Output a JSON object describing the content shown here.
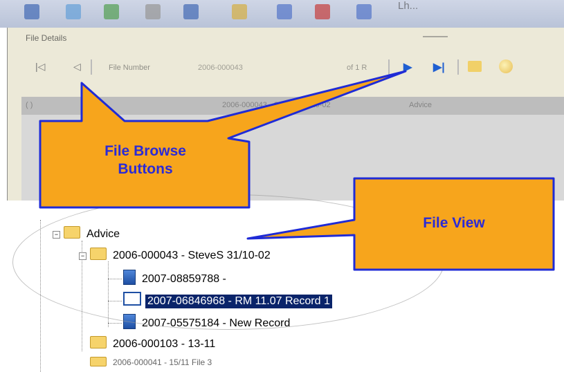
{
  "toolbar_strip": {
    "partial_text": "Lh..."
  },
  "file_details": {
    "title": "File Details",
    "field_label": "File Number",
    "field_value": "2006-000043",
    "record_count": "of 1 R",
    "grid_headers": [
      "( )",
      "2006-000043 - SteveS 31/10-02",
      "Advice"
    ]
  },
  "callouts": {
    "browse": "File Browse\nButtons",
    "view": "File View"
  },
  "tree": {
    "advice": "Advice",
    "file1": "2006-000043 - SteveS 31/10-02",
    "rec1": "2007-08859788 -",
    "rec2": "2007-06846968 - RM 11.07 Record 1",
    "rec3": "2007-05575184 - New Record",
    "file2": "2006-000103 - 13-11",
    "file3": "2006-000041 - 15/11 File 3"
  },
  "colors": {
    "callout_fill": "#f7a51c",
    "callout_border": "#1f2bd6",
    "selection": "#0a246a"
  }
}
